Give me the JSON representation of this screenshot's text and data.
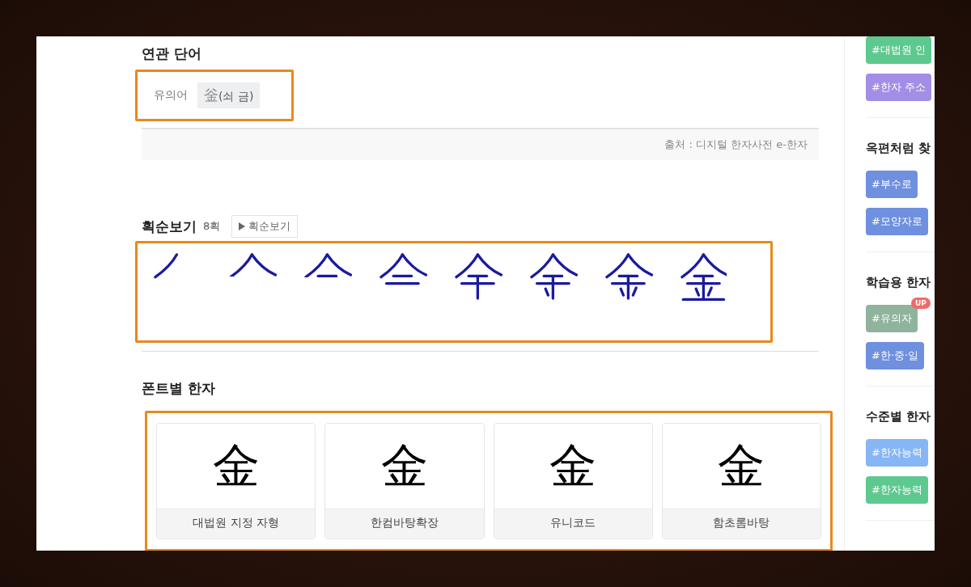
{
  "related_words": {
    "title": "연관 단어",
    "label": "유의어",
    "chips": [
      {
        "hanja": "釡",
        "reading": "(쇠 금)"
      }
    ]
  },
  "source": "출처 : 디지털 한자사전 e-한자",
  "stroke_order": {
    "title": "획순보기",
    "count": "8획",
    "button": "획순보기"
  },
  "fonts": {
    "title": "폰트별 한자",
    "cards": [
      {
        "glyph": "金",
        "name": "대법원 지정 자형"
      },
      {
        "glyph": "金",
        "name": "한컴바탕확장"
      },
      {
        "glyph": "金",
        "name": "유니코드"
      },
      {
        "glyph": "金",
        "name": "함초롬바탕"
      }
    ]
  },
  "sidebar": {
    "groups": [
      {
        "tags": [
          {
            "label": "#대법원 인",
            "color": "#5ec98f"
          },
          {
            "label": "#한자 주소",
            "color": "#a48de6"
          }
        ]
      },
      {
        "title": "옥편처럼 찾",
        "tags": [
          {
            "label": "#부수로",
            "color": "#6f8fdf"
          },
          {
            "label": "#모양자로",
            "color": "#6f8fdf"
          }
        ]
      },
      {
        "title": "학습용 한자",
        "tags": [
          {
            "label": "#유의자",
            "color": "#8fb39c",
            "badge": "UP"
          },
          {
            "label": "#한·중·일",
            "color": "#6f8fdf"
          }
        ]
      },
      {
        "title": "수준별 한자",
        "tags": [
          {
            "label": "#한자능력",
            "color": "#86b6f5"
          },
          {
            "label": "#한자능력",
            "color": "#5ec98f"
          }
        ]
      }
    ]
  }
}
